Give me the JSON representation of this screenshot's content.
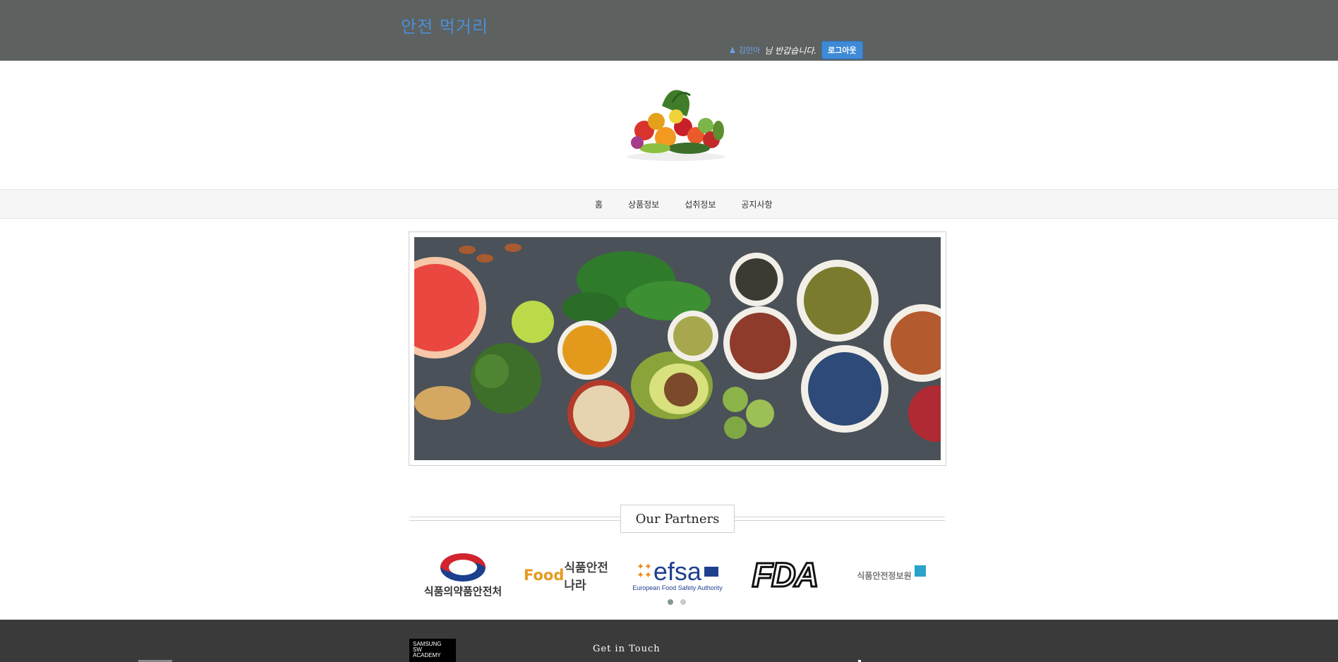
{
  "header": {
    "brand": "안전 먹거리",
    "user_name": "김민아",
    "greeting": "님 반갑습니다.",
    "logout_label": "로그아웃"
  },
  "nav": {
    "items": [
      {
        "label": "홈"
      },
      {
        "label": "상품정보"
      },
      {
        "label": "섭취정보"
      },
      {
        "label": "공지사항"
      }
    ]
  },
  "partners": {
    "title": "Our Partners",
    "logos": [
      {
        "name": "mfds",
        "text": "식품의약품안전처"
      },
      {
        "name": "foodsafetykorea",
        "text_food": "Food",
        "text_kr": "식품안전나라"
      },
      {
        "name": "efsa",
        "text_main": "efsa",
        "text_sub": "European Food Safety Authority"
      },
      {
        "name": "fda",
        "text": "FDA"
      },
      {
        "name": "foodsafety-info",
        "text": "식품안전정보원"
      }
    ],
    "page_count": 2,
    "active_page": 1
  },
  "footer": {
    "academy_lines": [
      "SAMSUNG",
      "SW",
      "ACADEMY"
    ],
    "get_in_touch": "Get in Touch"
  },
  "colors": {
    "topbar": "#5d6160",
    "brand": "#4b8fd6",
    "logout": "#3e8ad6",
    "footer": "#3a3a3a"
  }
}
